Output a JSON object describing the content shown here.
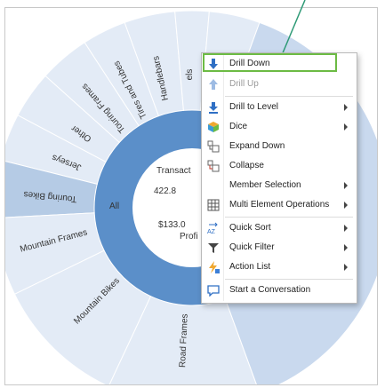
{
  "sunburst": {
    "center": {
      "top_label": "Transact",
      "top_value": "422.8",
      "bottom_value": "$133.0",
      "bottom_label": "Profi"
    },
    "root_label": "All",
    "segments": [
      "Handlebars",
      "Tires and Tubes",
      "Touring Frames",
      "Other",
      "Jerseys",
      "Touring Bikes",
      "Mountain Frames",
      "Mountain Bikes",
      "Road Frames",
      "els",
      "ets"
    ],
    "colors": {
      "root": "#5b8fc9",
      "ring": "#e3ebf6",
      "ring_selected": "#b5cbe5",
      "ring_stroke": "#ffffff",
      "annotation": "#2e9a76"
    }
  },
  "context_menu": {
    "items": [
      {
        "label": "Drill Down",
        "icon": "arrow-down-icon",
        "submenu": false,
        "enabled": true
      },
      {
        "label": "Drill Up",
        "icon": "arrow-up-icon",
        "submenu": false,
        "enabled": false
      },
      {
        "label": "Drill to Level",
        "icon": "drill-level-icon",
        "submenu": true,
        "enabled": true
      },
      {
        "label": "Dice",
        "icon": "cube-icon",
        "submenu": true,
        "enabled": true
      },
      {
        "label": "Expand Down",
        "icon": "expand-icon",
        "submenu": false,
        "enabled": true
      },
      {
        "label": "Collapse",
        "icon": "collapse-icon",
        "submenu": false,
        "enabled": true
      },
      {
        "label": "Member Selection",
        "icon": "",
        "submenu": true,
        "enabled": true
      },
      {
        "label": "Multi Element Operations",
        "icon": "grid-icon",
        "submenu": true,
        "enabled": true
      },
      {
        "label": "Quick Sort",
        "icon": "sort-az-icon",
        "submenu": true,
        "enabled": true
      },
      {
        "label": "Quick Filter",
        "icon": "filter-icon",
        "submenu": true,
        "enabled": true
      },
      {
        "label": "Action List",
        "icon": "lightning-icon",
        "submenu": true,
        "enabled": true
      },
      {
        "label": "Start a Conversation",
        "icon": "chat-icon",
        "submenu": false,
        "enabled": true
      }
    ]
  }
}
